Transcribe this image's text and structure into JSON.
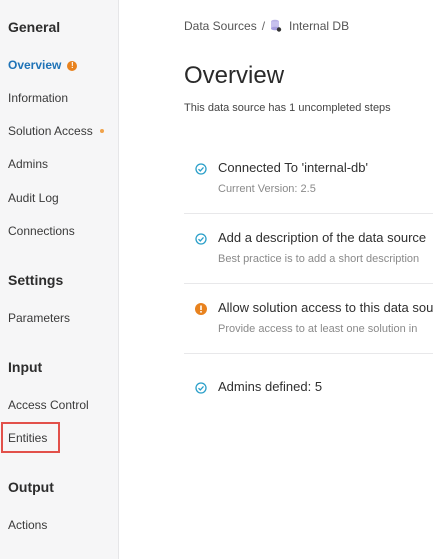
{
  "sidebar": {
    "sections": [
      {
        "title": "General",
        "items": [
          "Overview",
          "Information",
          "Solution Access",
          "Admins",
          "Audit Log",
          "Connections"
        ]
      },
      {
        "title": "Settings",
        "items": [
          "Parameters"
        ]
      },
      {
        "title": "Input",
        "items": [
          "Access Control",
          "Entities"
        ]
      },
      {
        "title": "Output",
        "items": [
          "Actions"
        ]
      }
    ],
    "active_item": "Overview",
    "overview_badge": "!",
    "highlighted_item": "Entities"
  },
  "breadcrumb": {
    "root": "Data Sources",
    "separator": "/",
    "current": "Internal DB"
  },
  "main": {
    "title": "Overview",
    "subtitle": "This data source has 1 uncompleted steps",
    "steps": [
      {
        "status": "done",
        "title": "Connected To 'internal-db'",
        "description": "Current Version: 2.5"
      },
      {
        "status": "done",
        "title": "Add a description of the data source",
        "description": "Best practice is to add a short description"
      },
      {
        "status": "warning",
        "title": "Allow solution access to this data source",
        "description": "Provide access to at least one solution in"
      },
      {
        "status": "done",
        "title": "Admins defined: 5",
        "description": ""
      }
    ]
  },
  "colors": {
    "accent": "#1f73b7",
    "done": "#2a9fc9",
    "warning": "#e8821e",
    "highlight": "#e2504a"
  }
}
